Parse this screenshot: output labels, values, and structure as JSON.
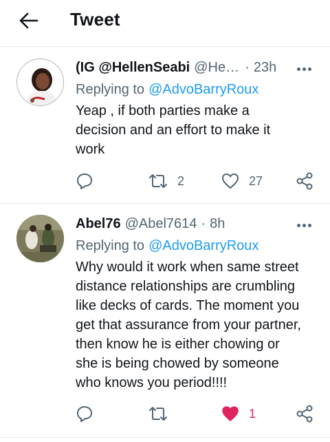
{
  "header": {
    "title": "Tweet",
    "back_icon": "arrow-left-icon"
  },
  "colors": {
    "link": "#1d9bf0",
    "like_active": "#e0245e",
    "secondary_text": "#536471"
  },
  "tweets": [
    {
      "name": "(IG @HellenSeabi",
      "handle": "@HellenSeabi",
      "time": "23h",
      "replying_label": "Replying to",
      "mention": "@AdvoBarryRoux",
      "text": "Yeap , if both parties make a\ndecision and an effort to make it\nwork",
      "retweets": "2",
      "likes": "27",
      "liked": false
    },
    {
      "name": "Abel76",
      "handle": "@Abel7614",
      "time": "8h",
      "replying_label": "Replying to",
      "mention": "@AdvoBarryRoux",
      "text": "Why would it work when same street\ndistance relationships are crumbling\nlike decks of cards. The moment you\nget that assurance from your partner,\nthen know he is either chowing or\nshe is being chowed by someone\nwho knows you period!!!!",
      "retweets": "",
      "likes": "1",
      "liked": true
    }
  ]
}
